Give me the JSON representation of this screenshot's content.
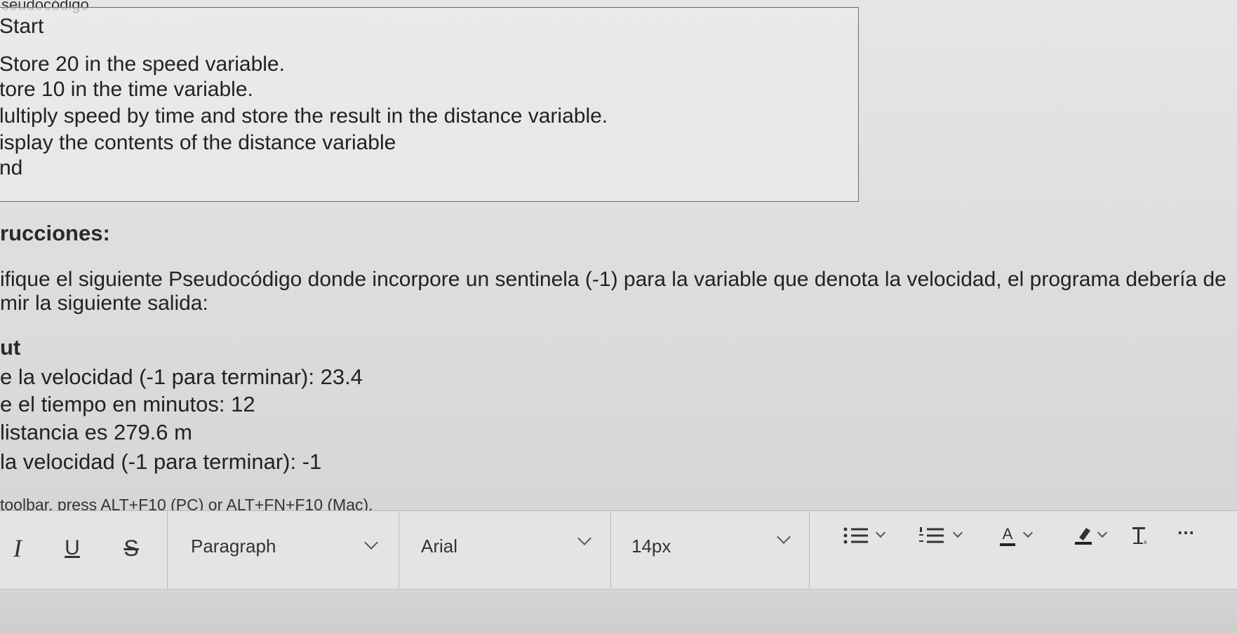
{
  "pseudocode": {
    "section_title": "seudocódigo",
    "lines": [
      "Start",
      "Store 20 in the speed variable.",
      "tore 10 in the time variable.",
      "lultiply speed by time and store the result in the distance variable.",
      "isplay the contents of the distance variable",
      "nd"
    ]
  },
  "instructions": {
    "heading": "rucciones:",
    "line1": "ifique el siguiente Pseudocódigo donde incorpore un sentinela (-1) para la variable que denota la velocidad, el programa debería de",
    "line2": "mir la siguiente salida:"
  },
  "output": {
    "heading": "ut",
    "lines": [
      "e la velocidad (-1 para terminar): 23.4",
      "e el tiempo en minutos: 12",
      "listancia es 279.6 m",
      "la velocidad (-1 para terminar): -1"
    ]
  },
  "toolbar": {
    "hint": "toolbar, press ALT+F10 (PC) or ALT+FN+F10 (Mac).",
    "italic_label": "I",
    "underline_label": "U",
    "strike_label": "S",
    "block_format": "Paragraph",
    "font_family": "Arial",
    "font_size": "14px",
    "text_color_label": "A",
    "more_label": "…",
    "icons": [
      "italic-icon",
      "underline-icon",
      "strikethrough-icon",
      "bullet-list-icon",
      "numbered-list-icon",
      "text-color-icon",
      "highlight-icon",
      "clear-format-icon",
      "more-icon"
    ]
  }
}
